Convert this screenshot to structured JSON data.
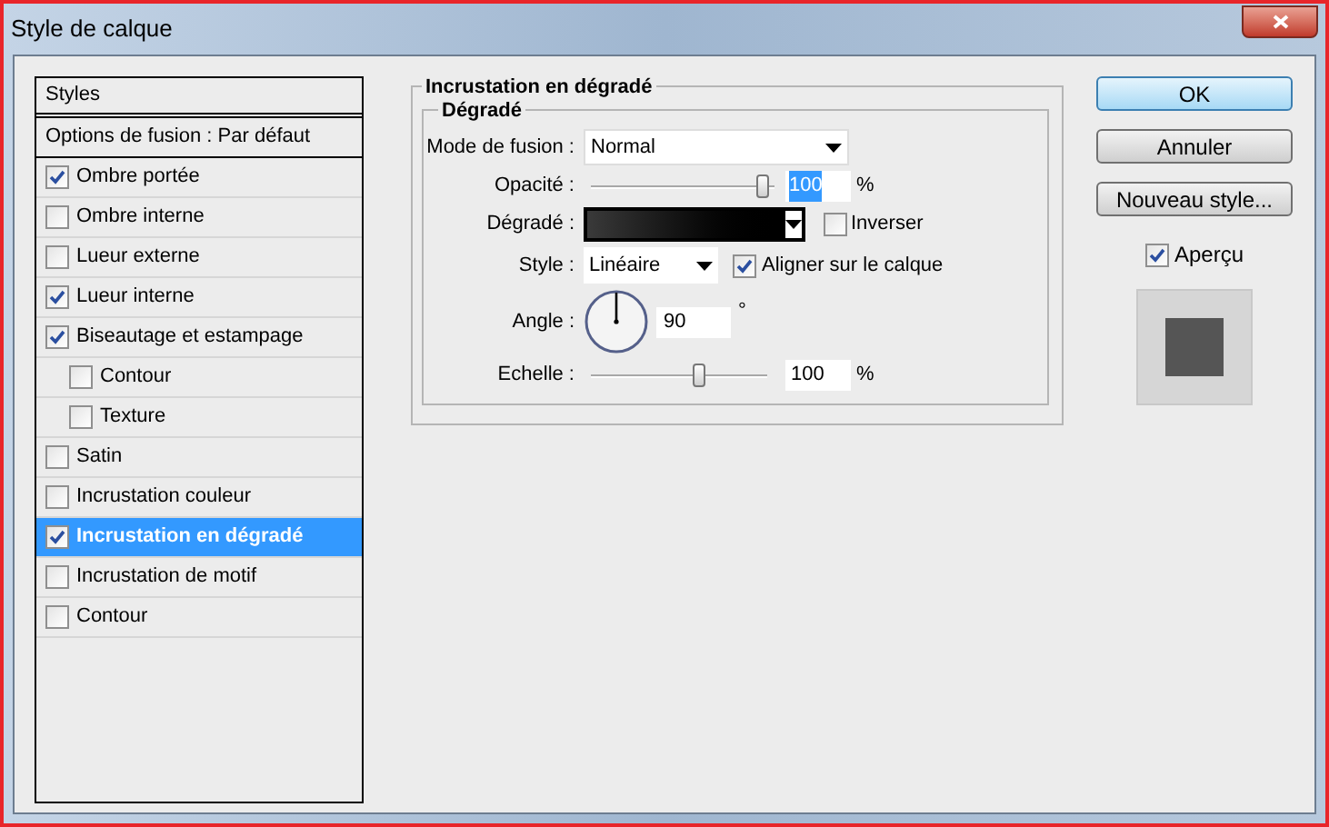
{
  "window": {
    "title": "Style de calque"
  },
  "styles": {
    "header": "Styles",
    "blending": "Options de fusion : Par défaut",
    "items": [
      {
        "label": "Ombre portée",
        "checked": true,
        "selected": false
      },
      {
        "label": "Ombre interne",
        "checked": false,
        "selected": false
      },
      {
        "label": "Lueur externe",
        "checked": false,
        "selected": false
      },
      {
        "label": "Lueur interne",
        "checked": true,
        "selected": false
      },
      {
        "label": "Biseautage et estampage",
        "checked": true,
        "selected": false,
        "children": [
          {
            "label": "Contour",
            "checked": false,
            "selected": false
          },
          {
            "label": "Texture",
            "checked": false,
            "selected": false
          }
        ]
      },
      {
        "label": "Satin",
        "checked": false,
        "selected": false
      },
      {
        "label": "Incrustation couleur",
        "checked": false,
        "selected": false
      },
      {
        "label": "Incrustation en dégradé",
        "checked": true,
        "selected": true
      },
      {
        "label": "Incrustation de motif",
        "checked": false,
        "selected": false
      },
      {
        "label": "Contour",
        "checked": false,
        "selected": false
      }
    ]
  },
  "panel": {
    "title": "Incrustation en dégradé",
    "group": "Dégradé",
    "blend_mode": {
      "label": "Mode de fusion :",
      "value": "Normal"
    },
    "opacity": {
      "label": "Opacité :",
      "level": 0.97,
      "value": "100",
      "highlighted": true,
      "unit": "%"
    },
    "gradient": {
      "label": "Dégradé :",
      "reverse": {
        "label": "Inverser",
        "checked": false
      }
    },
    "style": {
      "label": "Style :",
      "value": "Linéaire",
      "align": {
        "label": "Aligner sur le calque",
        "checked": true
      }
    },
    "angle": {
      "label": "Angle :",
      "value": "90",
      "unit": "°"
    },
    "scale": {
      "label": "Echelle :",
      "level": 0.62,
      "value": "100",
      "unit": "%"
    }
  },
  "buttons": [
    {
      "label": "OK",
      "default": true
    },
    {
      "label": "Annuler",
      "default": false
    },
    {
      "label": "Nouveau style...",
      "default": false
    }
  ],
  "preview": {
    "label": "Aperçu",
    "checked": true
  }
}
